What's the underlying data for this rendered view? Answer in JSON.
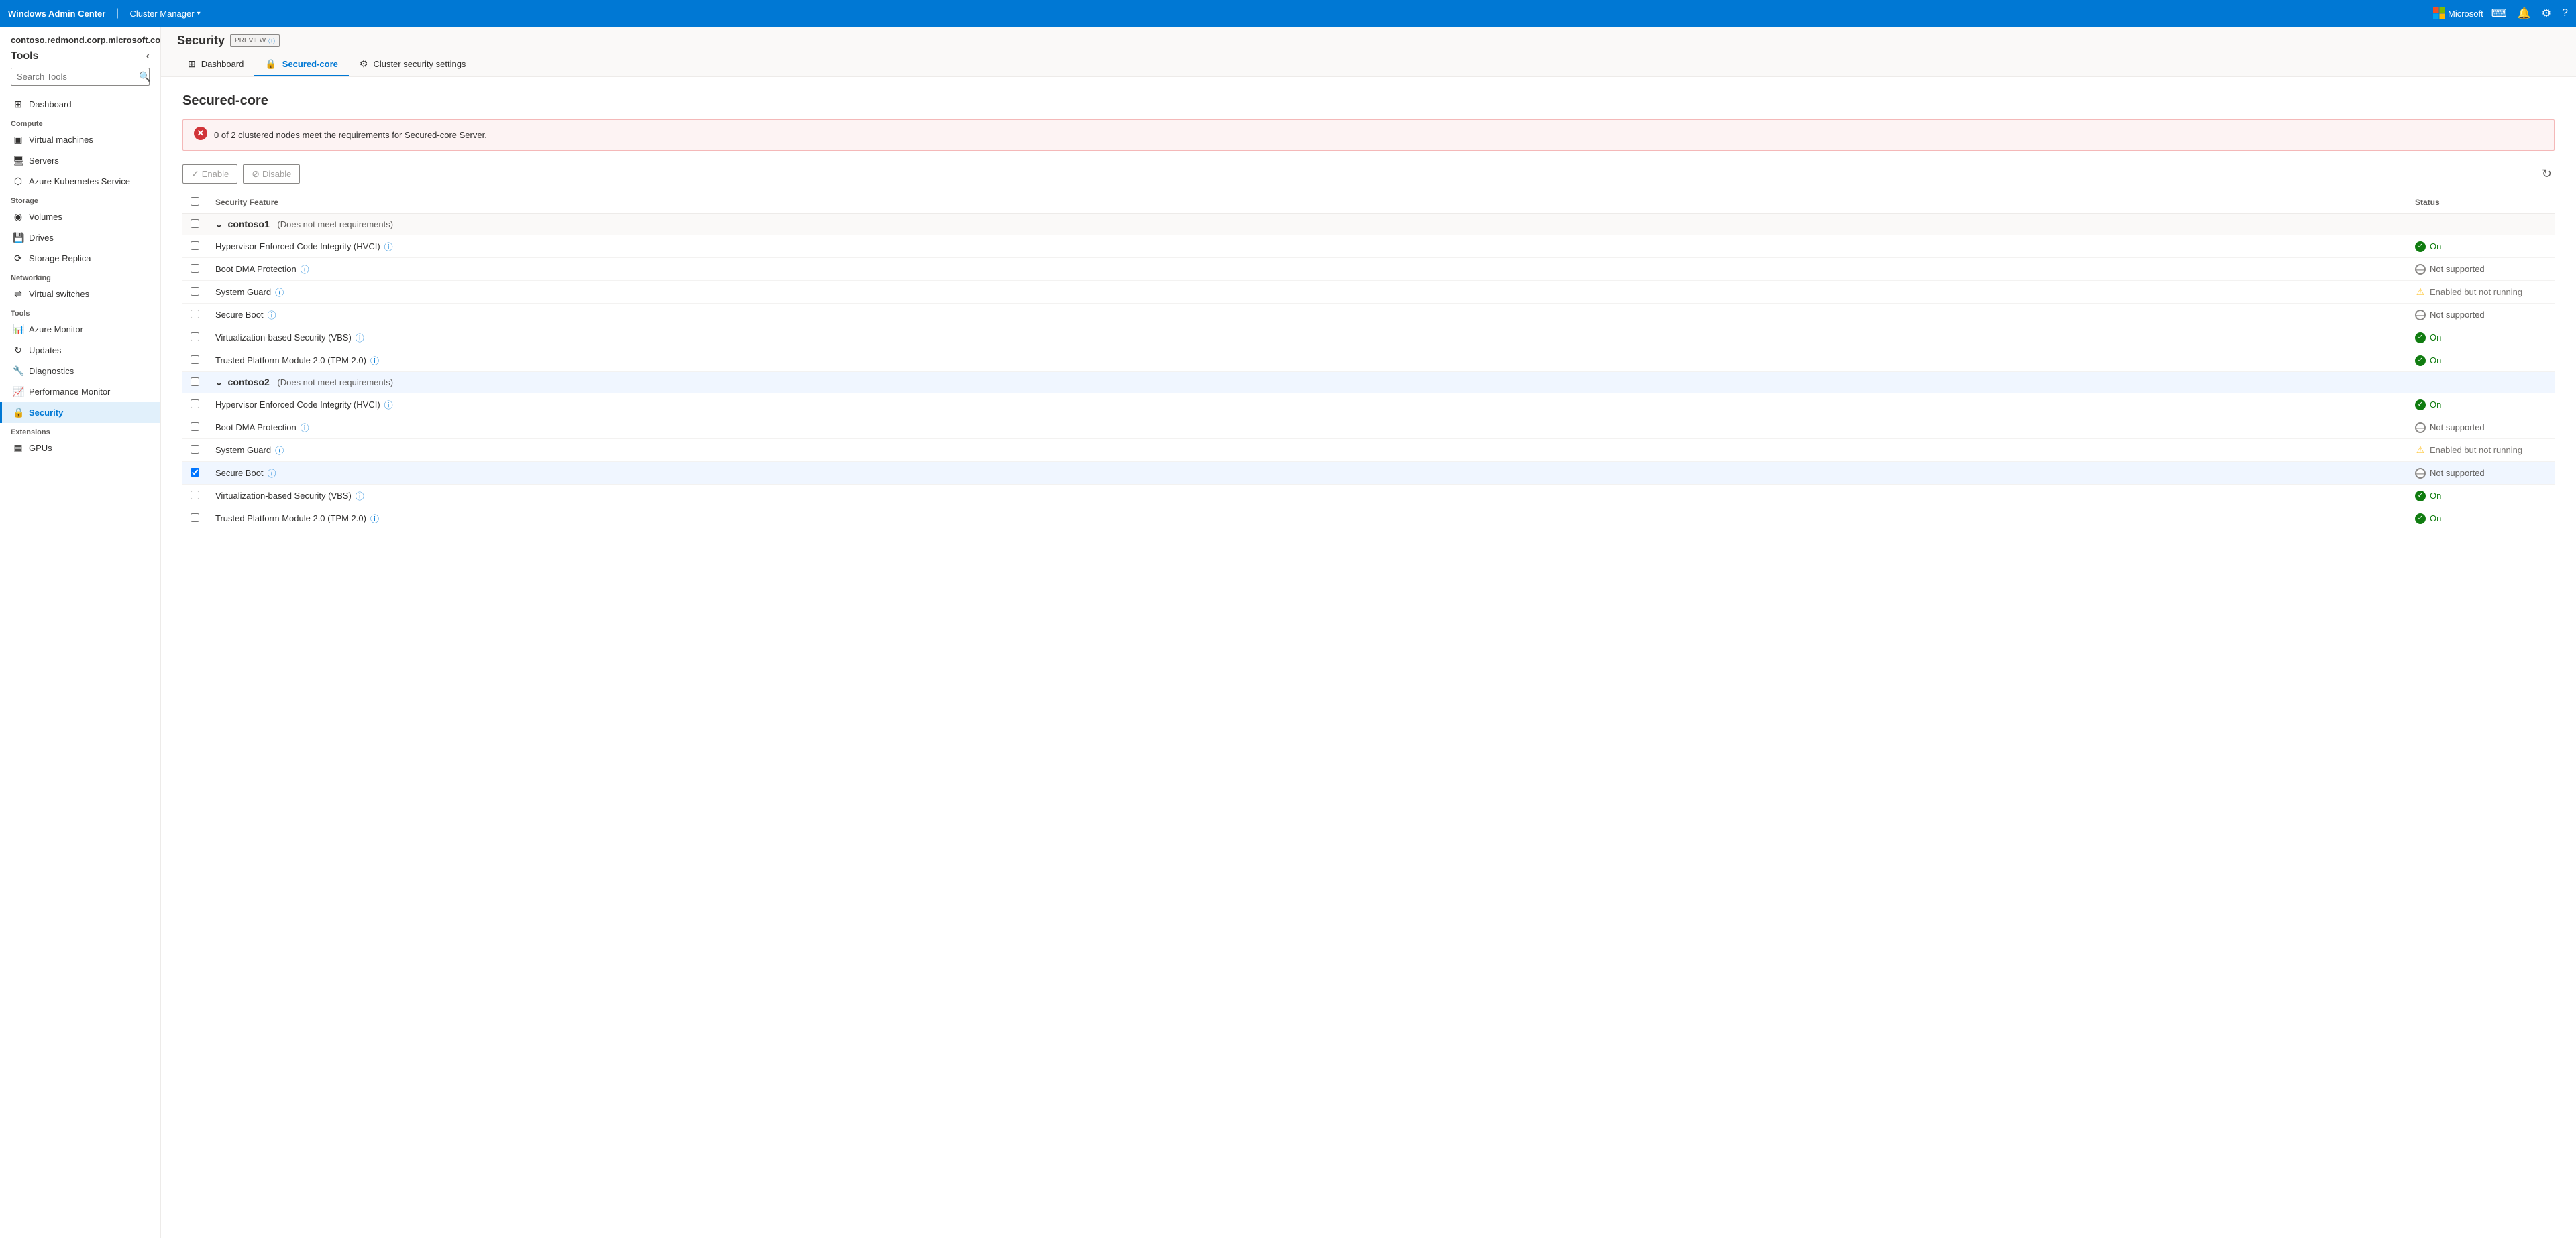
{
  "topbar": {
    "brand": "Windows Admin Center",
    "separator": "|",
    "cluster_label": "Cluster Manager",
    "microsoft_logo_text": "Microsoft",
    "icons": [
      "terminal",
      "bell",
      "settings",
      "help"
    ]
  },
  "sidebar": {
    "host": "contoso.redmond.corp.microsoft.com",
    "tools_label": "Tools",
    "search_placeholder": "Search Tools",
    "sections": [
      {
        "label": "",
        "items": [
          {
            "id": "dashboard",
            "label": "Dashboard",
            "icon": "⊞"
          }
        ]
      },
      {
        "label": "Compute",
        "items": [
          {
            "id": "virtual-machines",
            "label": "Virtual machines",
            "icon": "▣"
          },
          {
            "id": "servers",
            "label": "Servers",
            "icon": "🖥"
          },
          {
            "id": "azure-kubernetes",
            "label": "Azure Kubernetes Service",
            "icon": "⬡"
          }
        ]
      },
      {
        "label": "Storage",
        "items": [
          {
            "id": "volumes",
            "label": "Volumes",
            "icon": "◉"
          },
          {
            "id": "drives",
            "label": "Drives",
            "icon": "💾"
          },
          {
            "id": "storage-replica",
            "label": "Storage Replica",
            "icon": "⟳"
          }
        ]
      },
      {
        "label": "Networking",
        "items": [
          {
            "id": "virtual-switches",
            "label": "Virtual switches",
            "icon": "⇌"
          }
        ]
      },
      {
        "label": "Tools",
        "items": [
          {
            "id": "azure-monitor",
            "label": "Azure Monitor",
            "icon": "📊"
          },
          {
            "id": "updates",
            "label": "Updates",
            "icon": "↻"
          },
          {
            "id": "diagnostics",
            "label": "Diagnostics",
            "icon": "🔧"
          },
          {
            "id": "performance-monitor",
            "label": "Performance Monitor",
            "icon": "📈"
          },
          {
            "id": "security",
            "label": "Security",
            "icon": "🔒",
            "active": true
          }
        ]
      },
      {
        "label": "Extensions",
        "items": [
          {
            "id": "gpus",
            "label": "GPUs",
            "icon": "▦"
          }
        ]
      }
    ]
  },
  "subnav": {
    "title": "Security",
    "preview_label": "PREVIEW",
    "links": [
      {
        "id": "dashboard",
        "label": "Dashboard",
        "icon": "⊞",
        "active": false
      },
      {
        "id": "secured-core",
        "label": "Secured-core",
        "icon": "🔒",
        "active": true
      },
      {
        "id": "cluster-security-settings",
        "label": "Cluster security settings",
        "icon": "⚙",
        "active": false
      }
    ]
  },
  "content": {
    "title": "Secured-core",
    "alert": "0 of 2 clustered nodes meet the requirements for Secured-core Server.",
    "toolbar": {
      "enable_label": "Enable",
      "disable_label": "Disable"
    },
    "table": {
      "col_feature": "Security Feature",
      "col_status": "Status",
      "clusters": [
        {
          "id": "contoso1",
          "name": "contoso1",
          "note": "(Does not meet requirements)",
          "highlighted": false,
          "features": [
            {
              "name": "Hypervisor Enforced Code Integrity (HVCI)",
              "status": "on",
              "status_text": "On",
              "checked": false
            },
            {
              "name": "Boot DMA Protection",
              "status": "not-supported",
              "status_text": "Not supported",
              "checked": false
            },
            {
              "name": "System Guard",
              "status": "warning",
              "status_text": "Enabled but not running",
              "checked": false
            },
            {
              "name": "Secure Boot",
              "status": "not-supported",
              "status_text": "Not supported",
              "checked": false
            },
            {
              "name": "Virtualization-based Security (VBS)",
              "status": "on",
              "status_text": "On",
              "checked": false
            },
            {
              "name": "Trusted Platform Module 2.0 (TPM 2.0)",
              "status": "on",
              "status_text": "On",
              "checked": false
            }
          ]
        },
        {
          "id": "contoso2",
          "name": "contoso2",
          "note": "(Does not meet requirements)",
          "highlighted": true,
          "features": [
            {
              "name": "Hypervisor Enforced Code Integrity (HVCI)",
              "status": "on",
              "status_text": "On",
              "checked": false
            },
            {
              "name": "Boot DMA Protection",
              "status": "not-supported",
              "status_text": "Not supported",
              "checked": false
            },
            {
              "name": "System Guard",
              "status": "warning",
              "status_text": "Enabled but not running",
              "checked": false
            },
            {
              "name": "Secure Boot",
              "status": "not-supported",
              "status_text": "Not supported",
              "checked": true
            },
            {
              "name": "Virtualization-based Security (VBS)",
              "status": "on",
              "status_text": "On",
              "checked": false
            },
            {
              "name": "Trusted Platform Module 2.0 (TPM 2.0)",
              "status": "on",
              "status_text": "On",
              "checked": false
            }
          ]
        }
      ]
    }
  }
}
